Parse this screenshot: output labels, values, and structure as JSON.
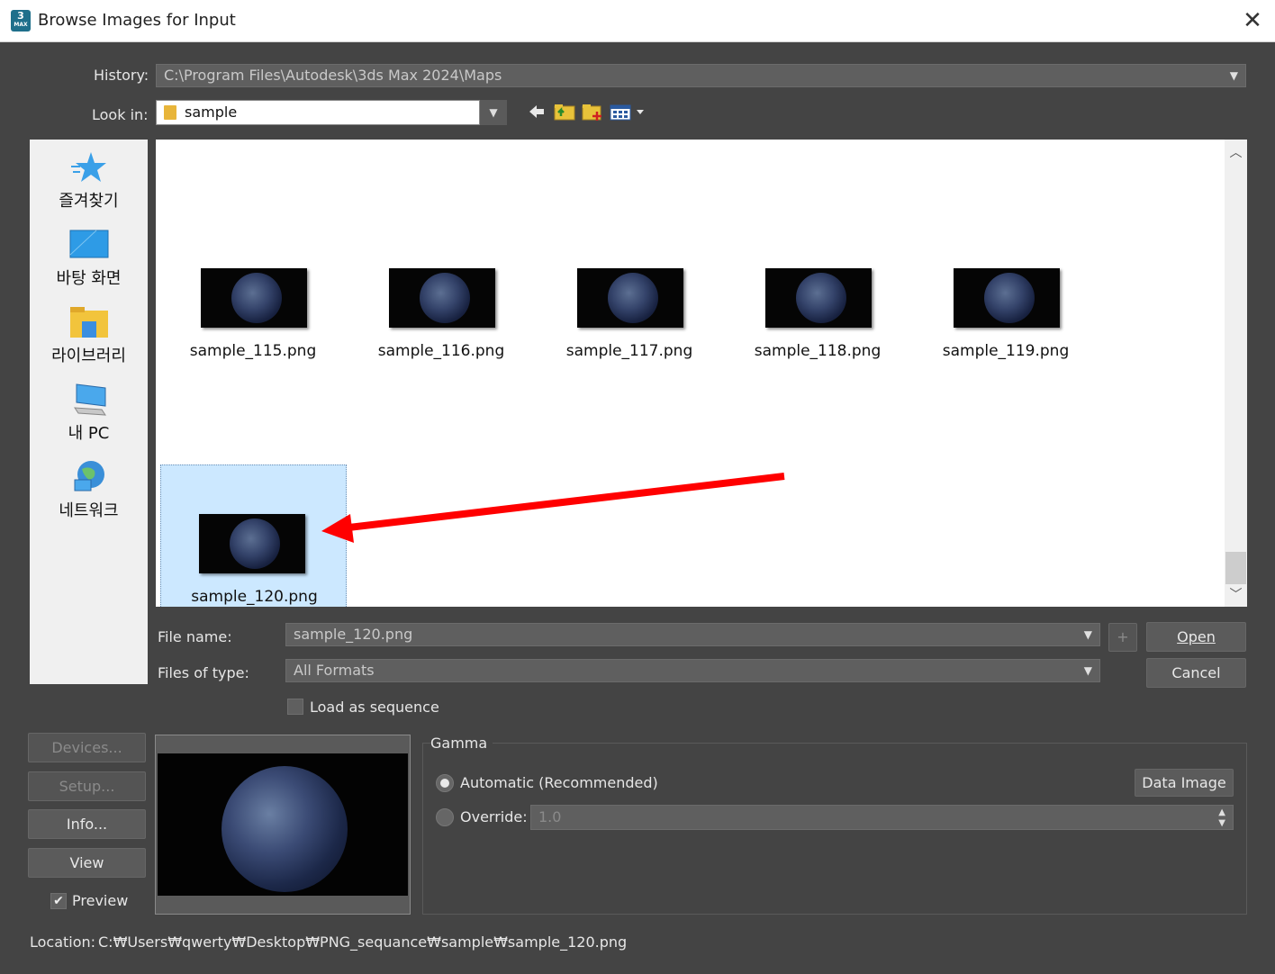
{
  "window": {
    "title": "Browse Images for Input",
    "icon_text": "3",
    "icon_subtext": "MAX",
    "close_glyph": "✕"
  },
  "history": {
    "label": "History:",
    "value": "C:\\Program Files\\Autodesk\\3ds Max 2024\\Maps"
  },
  "lookin": {
    "label": "Look in:",
    "value": "sample"
  },
  "places": [
    {
      "label": "즐겨찾기",
      "icon": "star-icon"
    },
    {
      "label": "바탕 화면",
      "icon": "desktop-icon"
    },
    {
      "label": "라이브러리",
      "icon": "library-folder-icon"
    },
    {
      "label": "내 PC",
      "icon": "computer-icon"
    },
    {
      "label": "네트워크",
      "icon": "network-globe-icon"
    }
  ],
  "files": [
    {
      "name": "sample_115.png"
    },
    {
      "name": "sample_116.png"
    },
    {
      "name": "sample_117.png"
    },
    {
      "name": "sample_118.png"
    },
    {
      "name": "sample_119.png"
    },
    {
      "name": "sample_120.png",
      "selected": true
    }
  ],
  "filename": {
    "label": "File name:",
    "value": "sample_120.png"
  },
  "filetype": {
    "label": "Files of type:",
    "value": "All Formats"
  },
  "buttons": {
    "open": "Open",
    "cancel": "Cancel",
    "plus": "+",
    "devices": "Devices...",
    "setup": "Setup...",
    "info": "Info...",
    "view": "View",
    "data_image": "Data Image"
  },
  "sequence": {
    "label": "Load as sequence",
    "checked": false
  },
  "preview": {
    "label": "Preview",
    "checked": true
  },
  "gamma": {
    "title": "Gamma",
    "automatic_label": "Automatic (Recommended)",
    "override_label": "Override:",
    "override_value": "1.0",
    "selected": "automatic"
  },
  "location": {
    "label": "Location:",
    "value": "C:₩Users₩qwerty₩Desktop₩PNG_sequance₩sample₩sample_120.png"
  },
  "colors": {
    "background": "#444444",
    "selection": "#cce8ff",
    "annotation_arrow": "#ff0000"
  }
}
